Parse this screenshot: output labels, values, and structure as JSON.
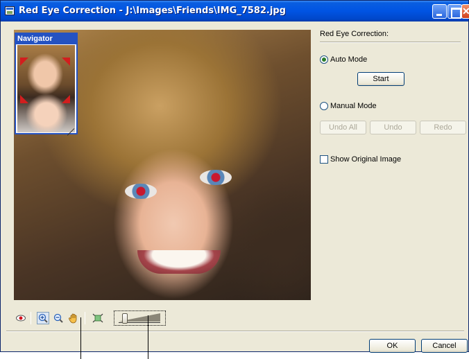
{
  "window": {
    "title": "Red Eye Correction - J:\\Images\\Friends\\IMG_7582.jpg"
  },
  "navigator": {
    "title": "Navigator"
  },
  "panel": {
    "heading": "Red Eye Correction:",
    "auto_mode_label": "Auto Mode",
    "auto_mode_selected": true,
    "start_label": "Start",
    "manual_mode_label": "Manual Mode",
    "manual_mode_selected": false,
    "undo_all_label": "Undo All",
    "undo_label": "Undo",
    "redo_label": "Redo",
    "show_original_label": "Show Original Image",
    "show_original_checked": false
  },
  "toolbar": {
    "icons": [
      "red-eye-icon",
      "zoom-in-icon",
      "zoom-out-icon",
      "hand-pan-icon",
      "fit-to-window-icon"
    ],
    "zoom_slider_level": 0.15
  },
  "footer": {
    "ok_label": "OK",
    "cancel_label": "Cancel"
  },
  "colors": {
    "title_bar": "#0054e3",
    "dialog_bg": "#ece9d8",
    "navigator_border": "#2452c2",
    "viewport_corners": "#d21e1e"
  }
}
